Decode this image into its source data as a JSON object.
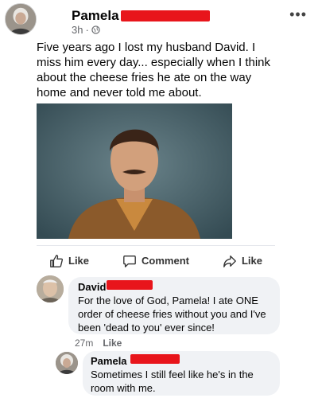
{
  "post": {
    "author": "Pamela",
    "time": "3h",
    "more": "•••",
    "text": "Five years ago I lost my husband David. I miss him every day... especially when I think about the cheese fries he ate on the way home and never told me about."
  },
  "actions": {
    "like": "Like",
    "comment": "Comment",
    "share": "Like"
  },
  "comments": [
    {
      "author": "David",
      "text": "For the love of God, Pamela! I ate ONE order of cheese fries without you and I've been 'dead to you' ever since!",
      "time": "27m",
      "like": "Like"
    },
    {
      "author": "Pamela",
      "text": "Sometimes I still feel like he's in the room with me."
    }
  ],
  "colors": {
    "redaction": "#e8151b",
    "bubble": "#f0f2f5",
    "meta": "#65676b"
  }
}
